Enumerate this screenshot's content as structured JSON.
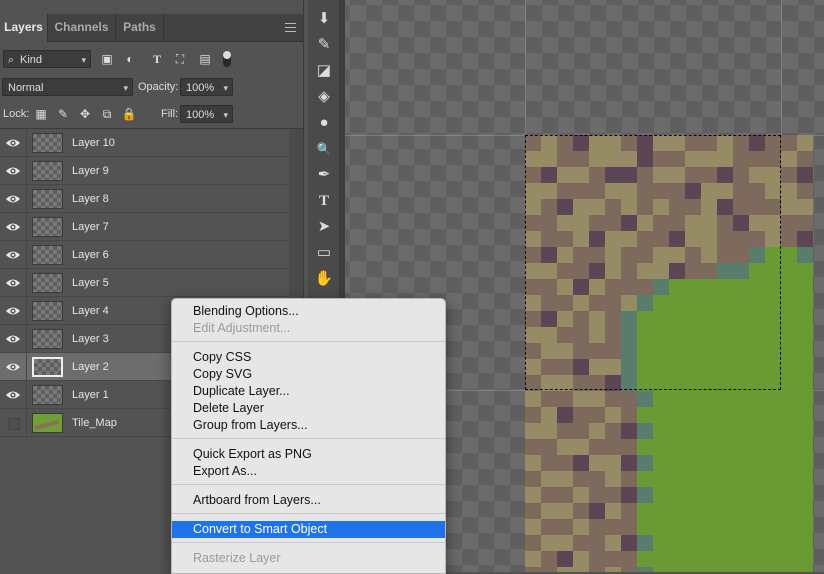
{
  "panel": {
    "tabs": [
      "Layers",
      "Channels",
      "Paths"
    ],
    "filter_label": "Kind",
    "filter_icons": [
      "image-filter-icon",
      "adjustment-filter-icon",
      "type-filter-icon",
      "shape-filter-icon",
      "smart-object-filter-icon",
      "filter-toggle-icon"
    ],
    "blend_mode": "Normal",
    "opacity_label": "Opacity:",
    "opacity_value": "100%",
    "lock_label": "Lock:",
    "lock_icons": [
      "lock-transparent-icon",
      "lock-image-icon",
      "lock-position-icon",
      "lock-artboard-icon",
      "lock-all-icon"
    ],
    "fill_label": "Fill:",
    "fill_value": "100%"
  },
  "layers": [
    {
      "name": "Layer 10",
      "visible": true,
      "selected": false,
      "thumb": "transparent"
    },
    {
      "name": "Layer 9",
      "visible": true,
      "selected": false,
      "thumb": "transparent"
    },
    {
      "name": "Layer 8",
      "visible": true,
      "selected": false,
      "thumb": "transparent"
    },
    {
      "name": "Layer 7",
      "visible": true,
      "selected": false,
      "thumb": "transparent"
    },
    {
      "name": "Layer 6",
      "visible": true,
      "selected": false,
      "thumb": "transparent"
    },
    {
      "name": "Layer 5",
      "visible": true,
      "selected": false,
      "thumb": "transparent"
    },
    {
      "name": "Layer 4",
      "visible": true,
      "selected": false,
      "thumb": "transparent"
    },
    {
      "name": "Layer 3",
      "visible": true,
      "selected": false,
      "thumb": "transparent"
    },
    {
      "name": "Layer 2",
      "visible": true,
      "selected": true,
      "thumb": "transparent"
    },
    {
      "name": "Layer 1",
      "visible": true,
      "selected": false,
      "thumb": "transparent"
    },
    {
      "name": "Tile_Map",
      "visible": false,
      "selected": false,
      "thumb": "map"
    }
  ],
  "tools": [
    {
      "name": "stamp-tool-icon",
      "glyph": "⬇"
    },
    {
      "name": "history-brush-tool-icon",
      "glyph": "✎"
    },
    {
      "name": "eraser-tool-icon",
      "glyph": "◪"
    },
    {
      "name": "paint-bucket-tool-icon",
      "glyph": "◈"
    },
    {
      "name": "blur-tool-icon",
      "glyph": "●"
    },
    {
      "name": "dodge-tool-icon",
      "glyph": "🔍"
    },
    {
      "name": "pen-tool-icon",
      "glyph": "✒"
    },
    {
      "name": "type-tool-icon",
      "glyph": "T"
    },
    {
      "name": "path-selection-tool-icon",
      "glyph": "➤"
    },
    {
      "name": "rectangle-tool-icon",
      "glyph": "▭"
    },
    {
      "name": "hand-tool-icon",
      "glyph": "✋"
    }
  ],
  "context_menu": [
    {
      "label": "Blending Options...",
      "enabled": true
    },
    {
      "label": "Edit Adjustment...",
      "enabled": false
    },
    {
      "sep": true
    },
    {
      "label": "Copy CSS",
      "enabled": true
    },
    {
      "label": "Copy SVG",
      "enabled": true
    },
    {
      "label": "Duplicate Layer...",
      "enabled": true
    },
    {
      "label": "Delete Layer",
      "enabled": true
    },
    {
      "label": "Group from Layers...",
      "enabled": true
    },
    {
      "sep": true
    },
    {
      "label": "Quick Export as PNG",
      "enabled": true
    },
    {
      "label": "Export As...",
      "enabled": true
    },
    {
      "sep": true
    },
    {
      "label": "Artboard from Layers...",
      "enabled": true
    },
    {
      "sep": true
    },
    {
      "label": "Convert to Smart Object",
      "enabled": true,
      "highlighted": true
    },
    {
      "sep": true
    },
    {
      "label": "Rasterize Layer",
      "enabled": false
    }
  ],
  "tile_map": {
    "colors": {
      "D": "#7e6a5c",
      "L": "#958b64",
      "P": "#5c4655",
      "G": "#6a9a34",
      "T": "#587d6c"
    },
    "rows": [
      "DLDPLLDPLLDDLDPDDL",
      "LLDDLLLPDDLLLDDDLD",
      "DPLLDPPDLLDDPDLLDP",
      "LLDDDLLDDDPLLDDLLD",
      "LDPLLDLDLDDLPDDDLL",
      "DDLLDDPLDDLLDPLLDD",
      "LDDLPLLDDPLLDDDLDP",
      "DPLDDLDDLLDLDDTGGT",
      "LLDDPLDLLPDDTTGGGG",
      "DDLPLDDDTGGGGGGGGG",
      "LDDLDDLTGGGGGGGGGG",
      "DPLDLDTGGGGGGGGGGG",
      "LLDDLDTGGGGGGGGGGG",
      "DLLDDDTGGGGGGGGGGG",
      "LDDPLLTGGGGGGGGGGG",
      "DLLDDPTGGGGGGGGGGG",
      "LDDLLDDTGGGGGGGGGG",
      "DLPDDLDGGGGGGGGGGG",
      "LLDDLDPTGGGGGGGGGG",
      "DDLLDDDGGGGGGGGGGG",
      "LDDPLLPTGGGGGGGGGG",
      "DLLDDLDGGGGGGGGGGG",
      "LDDLDDPTGGGGGGGGGG",
      "DLLDPLDGGGGGGGGGGG",
      "LDDLDDDGGGGGGGGGGG",
      "DLLDDLPTGGGGGGGGGG",
      "LDPLDDDGGGGGGGGGGG",
      "DDLLDLDTGGGGGGGGGG",
      "LLDDLDDGGGGGGGGGGG"
    ]
  }
}
